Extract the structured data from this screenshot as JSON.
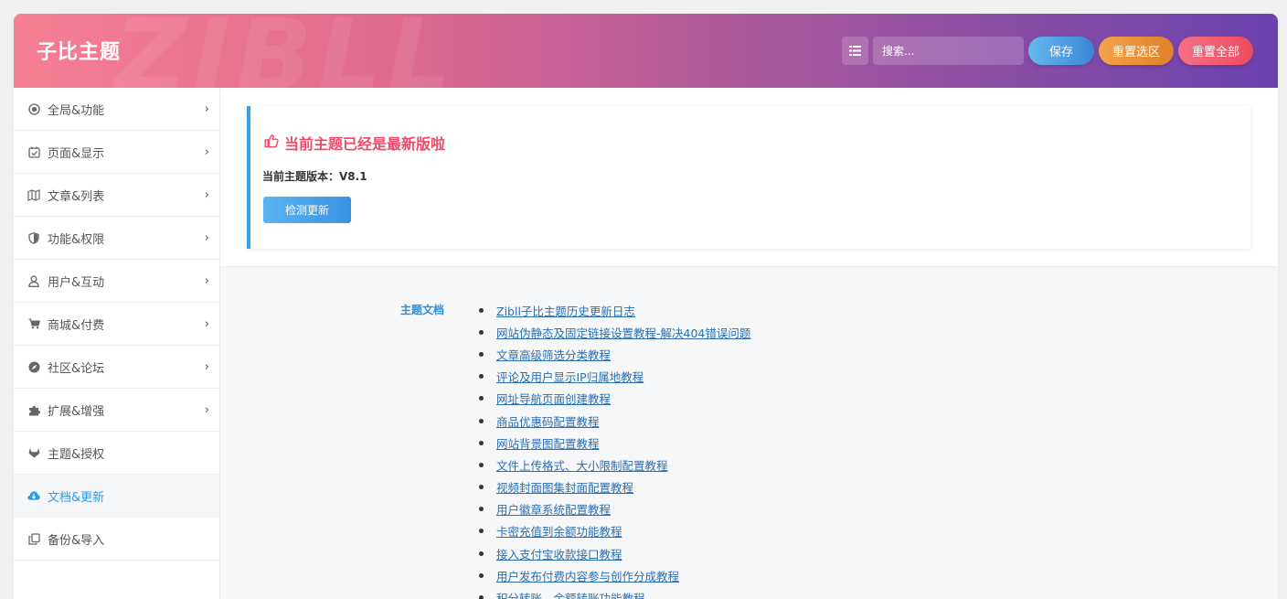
{
  "header": {
    "title": "子比主题",
    "watermark": "ZIBLL",
    "search_placeholder": "搜索...",
    "save_label": "保存",
    "reset_selection_label": "重置选区",
    "reset_all_label": "重置全部"
  },
  "sidebar": {
    "items": [
      {
        "label": "全局&功能",
        "icon": "target-icon",
        "arrow": true
      },
      {
        "label": "页面&显示",
        "icon": "calendar-check-icon",
        "arrow": true
      },
      {
        "label": "文章&列表",
        "icon": "map-icon",
        "arrow": true
      },
      {
        "label": "功能&权限",
        "icon": "shield-icon",
        "arrow": true
      },
      {
        "label": "用户&互动",
        "icon": "user-icon",
        "arrow": true
      },
      {
        "label": "商城&付费",
        "icon": "cart-icon",
        "arrow": true
      },
      {
        "label": "社区&论坛",
        "icon": "compass-icon",
        "arrow": true
      },
      {
        "label": "扩展&增强",
        "icon": "puzzle-icon",
        "arrow": true
      },
      {
        "label": "主题&授权",
        "icon": "gitlab-icon",
        "arrow": false
      },
      {
        "label": "文档&更新",
        "icon": "cloud-download-icon",
        "arrow": false,
        "active": true
      },
      {
        "label": "备份&导入",
        "icon": "copy-icon",
        "arrow": false
      }
    ]
  },
  "update": {
    "headline": "当前主题已经是最新版啦",
    "version_label": "当前主题版本：",
    "version_value": "V8.1",
    "check_button": "检测更新"
  },
  "docs": {
    "label": "主题文档",
    "links": [
      "Zibll子比主题历史更新日志",
      "网站伪静态及固定链接设置教程-解决404错误问题",
      "文章高级筛选分类教程",
      "评论及用户显示IP归属地教程",
      "网址导航页面创建教程",
      "商品优惠码配置教程",
      "网站背景图配置教程",
      "文件上传格式、大小限制配置教程",
      "视频封面图集封面配置教程",
      "用户徽章系统配置教程",
      "卡密充值到余额功能教程",
      "接入支付宝收款接口教程",
      "用户发布付费内容参与创作分成教程",
      "积分转账、余额转账功能教程"
    ]
  },
  "colors": {
    "accent_blue": "#2c9be6",
    "headline_red": "#ef4a68",
    "header_gradient_start": "#f77f93",
    "header_gradient_end": "#6a42ae"
  }
}
